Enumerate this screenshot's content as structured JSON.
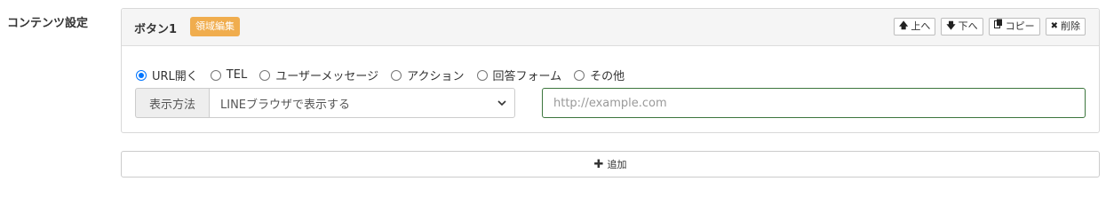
{
  "section": {
    "label": "コンテンツ設定"
  },
  "panel": {
    "title": "ボタン1",
    "badge": "領域編集",
    "actions": [
      {
        "icon": "arrow-up-icon",
        "label": "上へ"
      },
      {
        "icon": "arrow-down-icon",
        "label": "下へ"
      },
      {
        "icon": "copy-icon",
        "label": "コピー"
      },
      {
        "icon": "close-icon",
        "label": "削除"
      }
    ]
  },
  "action_types": {
    "options": [
      {
        "label": "URL開く",
        "checked": true
      },
      {
        "label": "TEL",
        "checked": false
      },
      {
        "label": "ユーザーメッセージ",
        "checked": false
      },
      {
        "label": "アクション",
        "checked": false
      },
      {
        "label": "回答フォーム",
        "checked": false
      },
      {
        "label": "その他",
        "checked": false
      }
    ]
  },
  "display_method": {
    "label": "表示方法",
    "selected": "LINEブラウザで表示する"
  },
  "url_input": {
    "value": "",
    "placeholder": "http://example.com"
  },
  "add_button": {
    "label": "追加"
  },
  "colors": {
    "badge": "#f0ad4e",
    "radio_checked": "#0075ff",
    "input_border": "#3c763d"
  }
}
